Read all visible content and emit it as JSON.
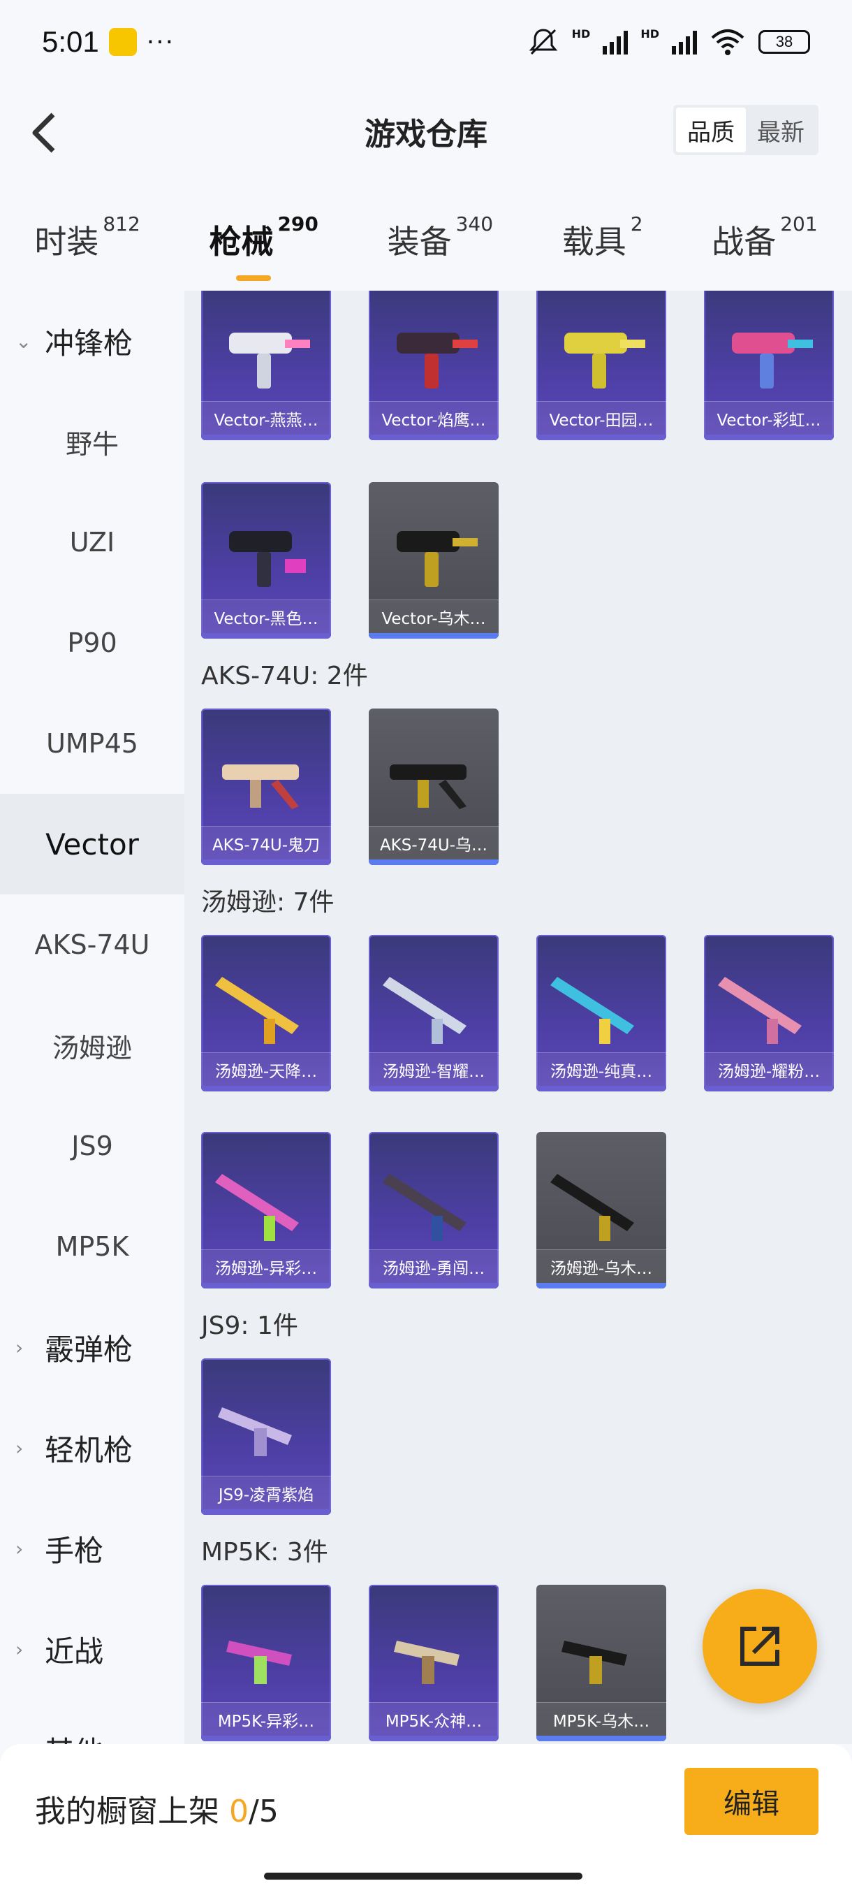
{
  "status": {
    "time": "5:01",
    "dots": "···",
    "battery": "38",
    "net1": "HD",
    "net2": "HD"
  },
  "header": {
    "title": "游戏仓库",
    "sort_quality": "品质",
    "sort_newest": "最新"
  },
  "tabs": [
    {
      "label": "时装",
      "count": "812"
    },
    {
      "label": "枪械",
      "count": "290"
    },
    {
      "label": "装备",
      "count": "340"
    },
    {
      "label": "载具",
      "count": "2"
    },
    {
      "label": "战备",
      "count": "201"
    }
  ],
  "sidebar": {
    "items": [
      {
        "label": "冲锋枪"
      },
      {
        "label": "野牛"
      },
      {
        "label": "UZI"
      },
      {
        "label": "P90"
      },
      {
        "label": "UMP45"
      },
      {
        "label": "Vector"
      },
      {
        "label": "AKS-74U"
      },
      {
        "label": "汤姆逊"
      },
      {
        "label": "JS9"
      },
      {
        "label": "MP5K"
      },
      {
        "label": "霰弹枪"
      },
      {
        "label": "轻机枪"
      },
      {
        "label": "手枪"
      },
      {
        "label": "近战"
      },
      {
        "label": "其他"
      }
    ]
  },
  "sections": {
    "aks": "AKS-74U: 2件",
    "thompson": "汤姆逊: 7件",
    "js9": "JS9: 1件",
    "mp5k": "MP5K: 3件"
  },
  "cards": {
    "v1": "Vector-燕燕…",
    "v2": "Vector-焰鹰…",
    "v3": "Vector-田园…",
    "v4": "Vector-彩虹…",
    "v5": "Vector-黑色…",
    "v6": "Vector-乌木…",
    "a1": "AKS-74U-鬼刀",
    "a2": "AKS-74U-乌…",
    "t1": "汤姆逊-天降…",
    "t2": "汤姆逊-智耀…",
    "t3": "汤姆逊-纯真…",
    "t4": "汤姆逊-耀粉…",
    "t5": "汤姆逊-异彩…",
    "t6": "汤姆逊-勇闯…",
    "t7": "汤姆逊-乌木…",
    "j1": "JS9-凌霄紫焰",
    "m1": "MP5K-异彩…",
    "m2": "MP5K-众神…",
    "m3": "MP5K-乌木…"
  },
  "bottom": {
    "label": "我的橱窗上架 ",
    "used": "0",
    "total": "/5",
    "edit": "编辑"
  },
  "colors": {
    "accent": "#f7ac19",
    "card_purple": "#4e3fa6",
    "card_grey": "#4a4a52"
  }
}
